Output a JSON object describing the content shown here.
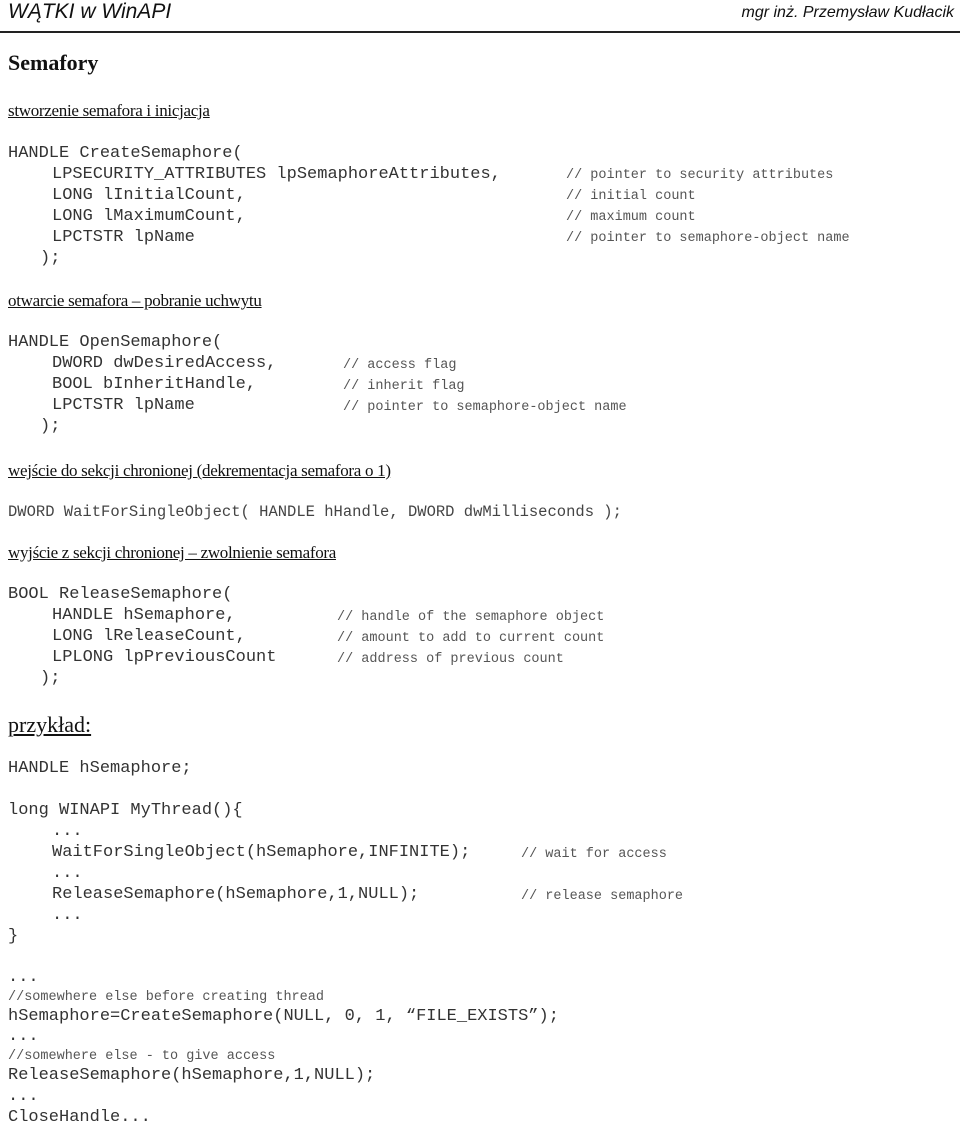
{
  "header": {
    "title": "WĄTKI w WinAPI",
    "author": "mgr inż. Przemysław Kudłacik"
  },
  "page_title": "Semafory",
  "sections": {
    "create": {
      "heading": "stworzenie semafora i inicjacja",
      "lines": [
        "HANDLE CreateSemaphore(",
        "LPSECURITY_ATTRIBUTES lpSemaphoreAttributes,",
        "LONG lInitialCount,",
        "LONG lMaximumCount,",
        "LPCTSTR lpName",
        ");"
      ],
      "comments": [
        "// pointer to security attributes",
        "// initial count",
        "// maximum count",
        "// pointer to semaphore-object name"
      ]
    },
    "open": {
      "heading": "otwarcie semafora – pobranie uchwytu",
      "lines": [
        "HANDLE OpenSemaphore(",
        "DWORD dwDesiredAccess,",
        "BOOL bInheritHandle,",
        "LPCTSTR lpName",
        ");"
      ],
      "comments": [
        "// access flag",
        "// inherit flag",
        "// pointer to semaphore-object name"
      ]
    },
    "enter": {
      "heading": "wejście do sekcji chronionej (dekrementacja semafora o 1)",
      "line": "DWORD WaitForSingleObject( HANDLE hHandle, DWORD dwMilliseconds );"
    },
    "leave": {
      "heading": "wyjście z sekcji chronionej – zwolnienie semafora",
      "lines": [
        "BOOL ReleaseSemaphore(",
        "HANDLE hSemaphore,",
        "LONG lReleaseCount,",
        "LPLONG lpPreviousCount",
        ");"
      ],
      "comments": [
        "// handle of the semaphore object",
        "// amount to add to current count",
        "// address of previous count"
      ]
    },
    "example": {
      "heading": "przykład:",
      "decl": "HANDLE hSemaphore;",
      "func_open": "long WINAPI MyThread(){",
      "ellipsis": "...",
      "wait_call": "WaitForSingleObject(hSemaphore,INFINITE);",
      "wait_comment": "// wait for access",
      "release_call": "ReleaseSemaphore(hSemaphore,1,NULL);",
      "release_comment": "// release semaphore",
      "func_close": "}",
      "comment_create": "//somewhere else before creating thread",
      "create_call": "hSemaphore=CreateSemaphore(NULL, 0, 1, “FILE_EXISTS”);",
      "comment_give": "//somewhere else - to give access",
      "release_call2": "ReleaseSemaphore(hSemaphore,1,NULL);",
      "close_call": "CloseHandle..."
    }
  }
}
